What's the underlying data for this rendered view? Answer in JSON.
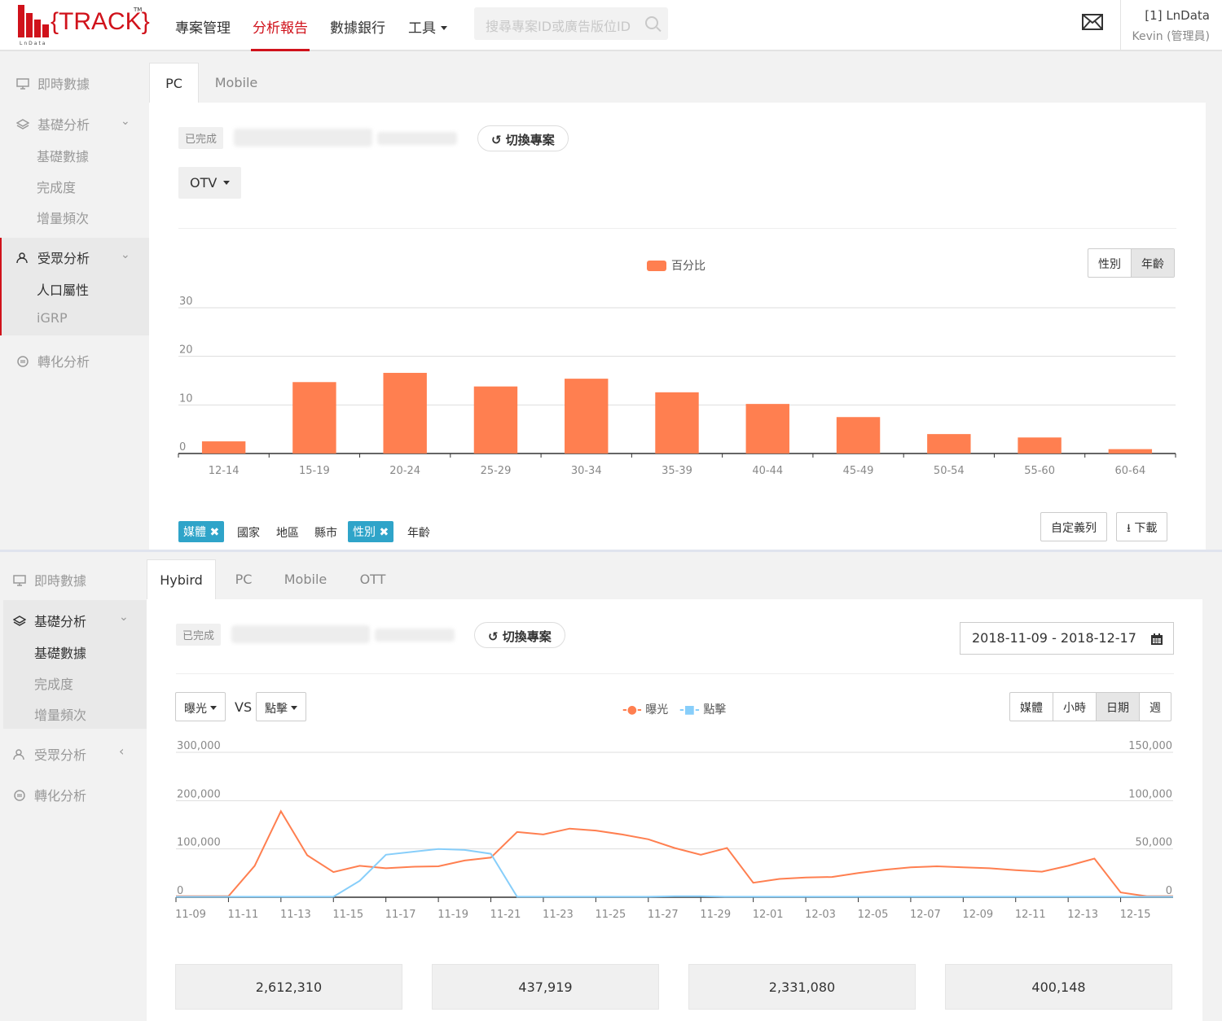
{
  "header": {
    "logo_text": "{TRACK}",
    "logo_sub": "LnData",
    "logo_tm": "TM",
    "nav": [
      "專案管理",
      "分析報告",
      "數據銀行",
      "工具"
    ],
    "search_placeholder": "搜尋專案ID或廣告版位ID",
    "user_line1": "[1] LnData",
    "user_line2": "Kevin (管理員)"
  },
  "top": {
    "sidebar": {
      "realtime": "即時數據",
      "basic": "基礎分析",
      "basic_subs": [
        "基礎數據",
        "完成度",
        "增量頻次"
      ],
      "audience": "受眾分析",
      "audience_subs": [
        "人口屬性",
        "iGRP"
      ],
      "conversion": "轉化分析"
    },
    "tabs": [
      "PC",
      "Mobile"
    ],
    "status": "已完成",
    "switch_label": "切換專案",
    "dropdown": "OTV",
    "legend": "百分比",
    "toggle": [
      "性別",
      "年齡"
    ],
    "filters": {
      "tag1": "媒體",
      "f1": "國家",
      "f2": "地區",
      "f3": "縣市",
      "tag2": "性別",
      "f4": "年齡"
    },
    "btn_custom": "自定義列",
    "btn_download": "下載"
  },
  "bottom": {
    "sidebar": {
      "realtime": "即時數據",
      "basic": "基礎分析",
      "basic_subs": [
        "基礎數據",
        "完成度",
        "增量頻次"
      ],
      "audience": "受眾分析",
      "conversion": "轉化分析"
    },
    "tabs": [
      "Hybird",
      "PC",
      "Mobile",
      "OTT"
    ],
    "status": "已完成",
    "switch_label": "切換專案",
    "date_range": "2018-11-09 - 2018-12-17",
    "sel1": "曝光",
    "vs": "VS",
    "sel2": "點擊",
    "legend1": "曝光",
    "legend2": "點擊",
    "toggle": [
      "媒體",
      "小時",
      "日期",
      "週"
    ],
    "stats": [
      "2,612,310",
      "437,919",
      "2,331,080",
      "400,148"
    ]
  },
  "colors": {
    "accent": "#d0121b",
    "bar": "#ff7f50",
    "line2": "#87cefa",
    "tag": "#2fa4c9"
  },
  "chart_data": [
    {
      "type": "bar",
      "categories": [
        "12-14",
        "15-19",
        "20-24",
        "25-29",
        "30-34",
        "35-39",
        "40-44",
        "45-49",
        "50-54",
        "55-60",
        "60-64"
      ],
      "series": [
        {
          "name": "百分比",
          "values": [
            2.5,
            14.7,
            16.6,
            13.8,
            15.4,
            12.6,
            10.2,
            7.5,
            4.0,
            3.3,
            0.9
          ]
        }
      ],
      "yticks": [
        "0",
        "10",
        "20",
        "30"
      ],
      "ylim": [
        0,
        30
      ]
    },
    {
      "type": "line",
      "x": [
        "11-09",
        "11-10",
        "11-11",
        "11-12",
        "11-13",
        "11-14",
        "11-15",
        "11-16",
        "11-17",
        "11-18",
        "11-19",
        "11-20",
        "11-21",
        "11-22",
        "11-23",
        "11-24",
        "11-25",
        "11-26",
        "11-27",
        "11-28",
        "11-29",
        "11-30",
        "12-01",
        "12-02",
        "12-03",
        "12-04",
        "12-05",
        "12-06",
        "12-07",
        "12-08",
        "12-09",
        "12-10",
        "12-11",
        "12-12",
        "12-13",
        "12-14",
        "12-15",
        "12-16",
        "12-17"
      ],
      "xticks": [
        "11-09",
        "11-11",
        "11-13",
        "11-15",
        "11-17",
        "11-19",
        "11-21",
        "11-23",
        "11-25",
        "11-27",
        "11-29",
        "12-01",
        "12-03",
        "12-05",
        "12-07",
        "12-09",
        "12-11",
        "12-13",
        "12-15"
      ],
      "series": [
        {
          "name": "曝光",
          "axis": "left",
          "values": [
            2000,
            2000,
            2000,
            65000,
            178000,
            87000,
            52000,
            65000,
            60000,
            63000,
            64000,
            76000,
            82000,
            135000,
            130000,
            142000,
            138000,
            130000,
            120000,
            102000,
            88000,
            102000,
            30000,
            38000,
            41000,
            42000,
            50000,
            57000,
            62000,
            64000,
            62000,
            60000,
            56000,
            53000,
            65000,
            80000,
            10000,
            2000,
            2000
          ]
        },
        {
          "name": "點擊",
          "axis": "right",
          "values": [
            500,
            500,
            500,
            500,
            500,
            500,
            500,
            17000,
            44000,
            47000,
            50000,
            49000,
            45000,
            500,
            500,
            500,
            500,
            500,
            500,
            1000,
            1000,
            500,
            500,
            500,
            500,
            500,
            500,
            500,
            500,
            500,
            500,
            500,
            500,
            500,
            500,
            500,
            500,
            500,
            500
          ]
        }
      ],
      "yticks_left": [
        "0",
        "100,000",
        "200,000",
        "300,000"
      ],
      "yticks_right": [
        "0",
        "50,000",
        "100,000",
        "150,000"
      ],
      "ylim_left": [
        0,
        300000
      ],
      "ylim_right": [
        0,
        150000
      ]
    }
  ]
}
